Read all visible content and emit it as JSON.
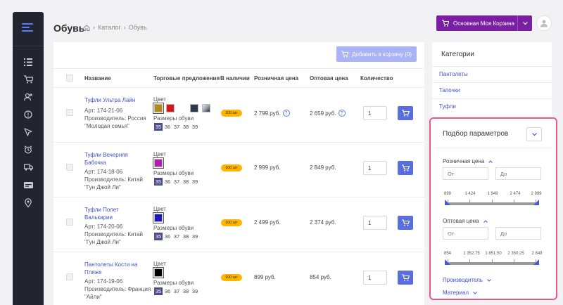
{
  "nav": {
    "icons": [
      "list-icon",
      "cart-icon",
      "user-add-icon",
      "alert-icon",
      "cursor-icon",
      "alarm-icon",
      "truck-icon",
      "card-icon",
      "location-icon"
    ]
  },
  "header": {
    "title": "Обувь",
    "breadcrumb": [
      "Каталог",
      "Обувь"
    ],
    "cart_button": "Основная Моя Корзина"
  },
  "table": {
    "add_to_cart": "Добавить в корзину (0)",
    "columns": [
      "Название",
      "Торговые предложения",
      "В наличии",
      "Розничная цена",
      "Оптовая цена",
      "Количество"
    ],
    "color_label": "Цвет",
    "sizes_label": "Размеры обуви",
    "rows": [
      {
        "name": "Туфли Ультра Лайн",
        "art": "Арт: 174-21-06",
        "maker": "Производитель: Россия \"Молодая семья\"",
        "colors": [
          "#b58a12",
          "#d8141c",
          "#ffffff",
          "#2e3a4a",
          "#9aa0b0"
        ],
        "sizes": [
          "35",
          "36",
          "37",
          "38",
          "39"
        ],
        "stock": "100 шт",
        "retail": "2 799 руб.",
        "wholesale": "2 659 руб.",
        "qty": "1"
      },
      {
        "name": "Туфли Вечерняя Бабочка",
        "art": "Арт: 174-18-06",
        "maker": "Производитель: Китай \"Гун Джой Ли\"",
        "colors": [
          "#b01fb3"
        ],
        "sizes": [
          "35",
          "36",
          "37",
          "38",
          "39"
        ],
        "stock": "100 шт",
        "retail": "2 999 руб.",
        "wholesale": "2 849 руб.",
        "qty": "1"
      },
      {
        "name": "Туфли Полет Валькирии",
        "art": "Арт: 174-20-06",
        "maker": "Производитель: Китай \"Гун Джой Ли\"",
        "colors": [
          "#1e1ab8"
        ],
        "sizes": [
          "35",
          "36",
          "37",
          "38",
          "39"
        ],
        "stock": "100 шт",
        "retail": "2 499 руб.",
        "wholesale": "2 374 руб.",
        "qty": "1"
      },
      {
        "name": "Пантолеты Кости на Пляже",
        "art": "Арт: 174-19-06",
        "maker": "Производитель: Франция \"Айли\"",
        "colors": [
          "#000000"
        ],
        "sizes": [
          "35",
          "36",
          "37",
          "38",
          "39"
        ],
        "stock": "100 шт",
        "retail": "899 руб.",
        "wholesale": "854 руб.",
        "qty": "1"
      }
    ]
  },
  "categories": {
    "title": "Категории",
    "items": [
      "Пантолеты",
      "Тапочки",
      "Туфли"
    ]
  },
  "filter": {
    "title": "Подбор параметров",
    "retail": {
      "label": "Розничная цена",
      "from": "От",
      "to": "До",
      "ticks": [
        "899",
        "1 424",
        "1 949",
        "2 474",
        "2 999"
      ]
    },
    "wholesale": {
      "label": "Оптовая цена",
      "from": "От",
      "to": "До",
      "ticks": [
        "854",
        "1 352.75",
        "1 851.50",
        "2 350.25",
        "2 849"
      ]
    },
    "maker": "Производитель",
    "material": "Материал"
  },
  "colors": {
    "accent": "#7b1fa2",
    "link": "#3f51c8",
    "button": "#5a6ee4",
    "badge": "#ffb400",
    "highlight": "#e95a86"
  }
}
